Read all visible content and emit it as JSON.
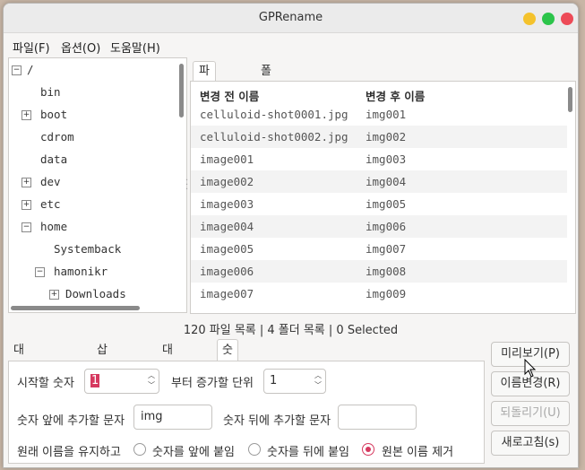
{
  "window": {
    "title": "GPRename"
  },
  "menubar": [
    "파일(F)",
    "옵션(O)",
    "도움말(H)"
  ],
  "tree": [
    {
      "label": "/",
      "box": "−",
      "level": 0
    },
    {
      "label": "bin",
      "box": "",
      "level": 1
    },
    {
      "label": "boot",
      "box": "+",
      "level": 1
    },
    {
      "label": "cdrom",
      "box": "",
      "level": 1
    },
    {
      "label": "data",
      "box": "",
      "level": 1
    },
    {
      "label": "dev",
      "box": "+",
      "level": 1
    },
    {
      "label": "etc",
      "box": "+",
      "level": 1
    },
    {
      "label": "home",
      "box": "−",
      "level": 1
    },
    {
      "label": "Systemback",
      "box": "",
      "level": 2
    },
    {
      "label": "hamonikr",
      "box": "−",
      "level": 2
    },
    {
      "label": "Downloads",
      "box": "+",
      "level": 3
    }
  ],
  "file_tabs": [
    "파일 목록",
    "폴더 목록"
  ],
  "file_list": {
    "columns": [
      "변경 전 이름",
      "변경 후 이름"
    ],
    "rows": [
      [
        "celluloid-shot0001.jpg",
        "img001"
      ],
      [
        "celluloid-shot0002.jpg",
        "img002"
      ],
      [
        "image001",
        "img003"
      ],
      [
        "image002",
        "img004"
      ],
      [
        "image003",
        "img005"
      ],
      [
        "image004",
        "img006"
      ],
      [
        "image005",
        "img007"
      ],
      [
        "image006",
        "img008"
      ],
      [
        "image007",
        "img009"
      ]
    ]
  },
  "status": "120 파일 목록 | 4 폴더 목록 | 0 Selected",
  "option_tabs": [
    "대소문자 변경",
    "삽입 / 삭제",
    "대체/제거",
    "숫자변환"
  ],
  "numeric": {
    "start_label": "시작할 숫자",
    "start_value": "1",
    "increment_label": "부터 증가할 단위",
    "increment_value": "1",
    "prefix_label": "숫자 앞에 추가할 문자",
    "prefix_value": "img",
    "suffix_label": "숫자 뒤에 추가할 문자",
    "suffix_value": "",
    "keep_label": "원래 이름을 유지하고",
    "radios": [
      {
        "label": "숫자를 앞에 붙임",
        "checked": false
      },
      {
        "label": "숫자를 뒤에 붙임",
        "checked": false
      },
      {
        "label": "원본 이름 제거",
        "checked": true
      }
    ]
  },
  "buttons": {
    "preview": "미리보기(P)",
    "rename": "이름변경(R)",
    "undo": "되돌리기(U)",
    "refresh": "새로고침(s)"
  },
  "colors": {
    "close": "#ed4b57",
    "maximize": "#2bc44a",
    "minimize": "#f4c22c",
    "radio_accent": "#d6395f"
  }
}
